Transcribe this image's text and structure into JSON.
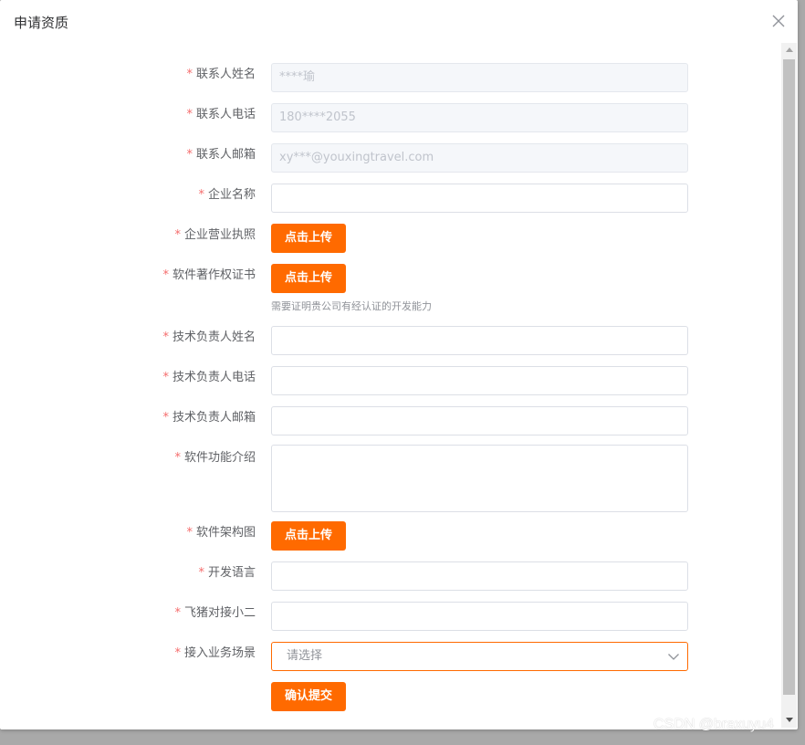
{
  "dialog": {
    "title": "申请资质"
  },
  "required_mark": "*",
  "form": {
    "contact_name": {
      "label": "联系人姓名",
      "value": "****瑜"
    },
    "contact_phone": {
      "label": "联系人电话",
      "value": "180****2055"
    },
    "contact_email": {
      "label": "联系人邮箱",
      "value": "xy***@youxingtravel.com"
    },
    "company_name": {
      "label": "企业名称",
      "value": ""
    },
    "business_license": {
      "label": "企业营业执照",
      "button": "点击上传"
    },
    "software_copyright": {
      "label": "软件著作权证书",
      "button": "点击上传",
      "hint": "需要证明贵公司有经认证的开发能力"
    },
    "tech_lead_name": {
      "label": "技术负责人姓名",
      "value": ""
    },
    "tech_lead_phone": {
      "label": "技术负责人电话",
      "value": ""
    },
    "tech_lead_email": {
      "label": "技术负责人邮箱",
      "value": ""
    },
    "software_intro": {
      "label": "软件功能介绍",
      "value": ""
    },
    "architecture": {
      "label": "软件架构图",
      "button": "点击上传"
    },
    "dev_language": {
      "label": "开发语言",
      "value": ""
    },
    "fliggy_contact": {
      "label": "飞猪对接小二",
      "value": ""
    },
    "business_scene": {
      "label": "接入业务场景",
      "placeholder": "请选择"
    },
    "submit_label": "确认提交"
  },
  "watermark": "CSDN @braxuyu4",
  "colors": {
    "accent": "#ff6a00",
    "required": "#f56c6c"
  }
}
